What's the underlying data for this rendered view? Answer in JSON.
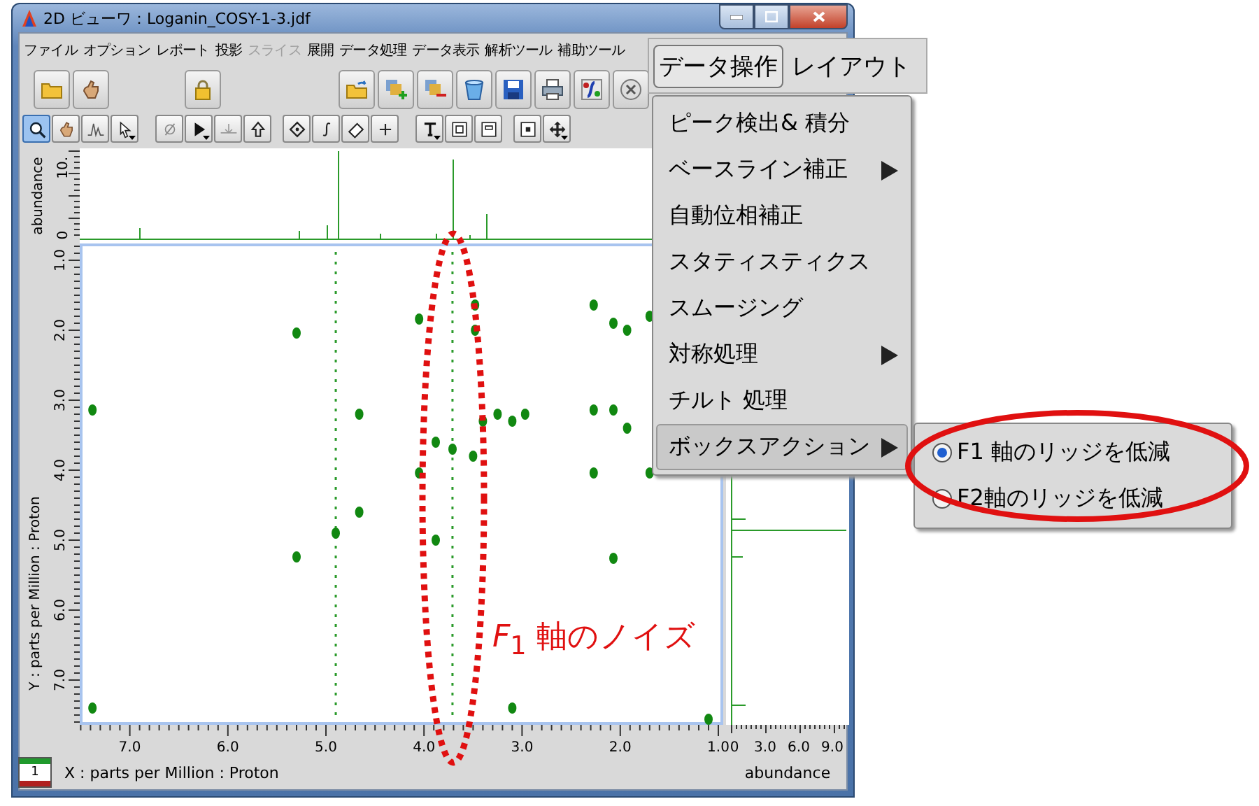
{
  "window": {
    "title": "2D ビューワ：Loganin_COSY-1-3.jdf"
  },
  "menubar": {
    "items": [
      {
        "label": "ファイル",
        "disabled": false
      },
      {
        "label": "オプション",
        "disabled": false
      },
      {
        "label": "レポート",
        "disabled": false
      },
      {
        "label": "投影",
        "disabled": false
      },
      {
        "label": "スライス",
        "disabled": true
      },
      {
        "label": "展開",
        "disabled": false
      },
      {
        "label": "データ処理",
        "disabled": false
      },
      {
        "label": "データ表示",
        "disabled": false
      },
      {
        "label": "解析ツール",
        "disabled": false
      },
      {
        "label": "補助ツール",
        "disabled": false
      }
    ]
  },
  "open_menu": {
    "items": [
      {
        "label": "データ操作",
        "selected": true
      },
      {
        "label": "レイアウト",
        "selected": false
      }
    ]
  },
  "toolbar_1": {
    "groups": [
      [
        {
          "kind": "folder"
        },
        {
          "kind": "hand"
        }
      ],
      [
        {
          "kind": "lock"
        }
      ],
      [
        {
          "kind": "folder-arrow"
        },
        {
          "kind": "layers-plus"
        },
        {
          "kind": "layers-minus"
        },
        {
          "kind": "bucket"
        },
        {
          "kind": "save"
        },
        {
          "kind": "printer"
        },
        {
          "kind": "script"
        },
        {
          "kind": "circle-x"
        }
      ]
    ]
  },
  "toolbar_2": {
    "groups": [
      [
        {
          "kind": "zoom",
          "selected": true,
          "dropdown": false
        },
        {
          "kind": "hand",
          "selected": false,
          "dropdown": false
        },
        {
          "kind": "peak",
          "selected": false,
          "dropdown": false
        },
        {
          "kind": "pointer",
          "selected": false,
          "dropdown": true
        }
      ],
      [
        {
          "kind": "empty-set",
          "selected": false,
          "dropdown": false
        },
        {
          "kind": "arrow",
          "selected": false,
          "dropdown": true
        },
        {
          "kind": "baseline",
          "selected": false,
          "dropdown": false
        },
        {
          "kind": "up-arrow",
          "selected": false,
          "dropdown": false
        }
      ],
      [
        {
          "kind": "diamond",
          "selected": false,
          "dropdown": false
        },
        {
          "kind": "integral",
          "selected": false,
          "dropdown": false
        },
        {
          "kind": "eraser",
          "selected": false,
          "dropdown": false
        },
        {
          "kind": "plus",
          "selected": false,
          "dropdown": false
        }
      ],
      [
        {
          "kind": "text-tool",
          "selected": false,
          "dropdown": true
        },
        {
          "kind": "panel",
          "selected": false,
          "dropdown": false
        },
        {
          "kind": "panel-corner",
          "selected": false,
          "dropdown": false
        }
      ],
      [
        {
          "kind": "square-dot",
          "selected": false,
          "dropdown": false
        },
        {
          "kind": "move",
          "selected": false,
          "dropdown": true
        }
      ]
    ]
  },
  "top_projection": {
    "ylabel": "abundance",
    "yticks": [
      "10.",
      "0"
    ]
  },
  "plot": {
    "chart_data": {
      "type": "scatter",
      "xlabel": "X : parts per Million : Proton",
      "ylabel": "Y : parts per Million : Proton",
      "ref_lines": [
        {
          "axis": "x",
          "value": 4.9
        },
        {
          "axis": "x",
          "value": 3.71
        }
      ],
      "xlim": [
        7.51,
        0.95
      ],
      "ylim": [
        7.64,
        0.76
      ],
      "xticks": [
        {
          "value": 7,
          "label": "7.0"
        },
        {
          "value": 6,
          "label": "6.0"
        },
        {
          "value": 5,
          "label": "5.0"
        },
        {
          "value": 4,
          "label": "4.0"
        },
        {
          "value": 3,
          "label": "3.0"
        },
        {
          "value": 2,
          "label": "2.0"
        },
        {
          "value": 1,
          "label": "1.0"
        }
      ],
      "yticks": [
        {
          "value": 1,
          "label": "1.0"
        },
        {
          "value": 2,
          "label": "2.0"
        },
        {
          "value": 3,
          "label": "3.0"
        },
        {
          "value": 4,
          "label": "4.0"
        },
        {
          "value": 5,
          "label": "5.0"
        },
        {
          "value": 6,
          "label": "6.0"
        },
        {
          "value": 7,
          "label": "7.0"
        }
      ],
      "x": [
        7.38,
        7.38,
        5.3,
        5.3,
        4.9,
        4.66,
        4.66,
        4.05,
        4.05,
        3.88,
        3.88,
        3.71,
        3.5,
        3.48,
        3.48,
        3.4,
        3.25,
        3.1,
        2.97,
        2.27,
        2.27,
        2.27,
        2.07,
        2.07,
        2.07,
        1.93,
        1.93,
        1.7,
        1.7,
        3.1,
        1.1
      ],
      "series": [
        {
          "color": "#118811",
          "values": [
            3.14,
            7.4,
            2.04,
            5.24,
            4.9,
            3.2,
            4.6,
            4.04,
            1.84,
            3.6,
            5.0,
            3.7,
            3.8,
            1.64,
            2.0,
            3.3,
            3.2,
            3.3,
            3.2,
            1.64,
            3.14,
            4.04,
            1.9,
            3.14,
            5.26,
            2.0,
            3.4,
            1.8,
            4.04,
            7.4,
            7.56
          ]
        }
      ]
    }
  },
  "right_projection": {
    "xticks": [
      "0",
      "3.0",
      "6.0",
      "9.0"
    ],
    "xlabel": "abundance"
  },
  "page_indicator": "1",
  "dropdown": {
    "items": [
      {
        "label": "ピーク検出& 積分",
        "submenu": false,
        "selected": false
      },
      {
        "label": "ベースライン補正",
        "submenu": true,
        "selected": false
      },
      {
        "label": "自動位相補正",
        "submenu": false,
        "selected": false
      },
      {
        "label": "スタティスティクス",
        "submenu": false,
        "selected": false
      },
      {
        "label": "スムージング",
        "submenu": false,
        "selected": false
      },
      {
        "label": "対称処理",
        "submenu": true,
        "selected": false
      },
      {
        "label": "チルト 処理",
        "submenu": false,
        "selected": false
      },
      {
        "label": "ボックスアクション",
        "submenu": true,
        "selected": true
      }
    ]
  },
  "submenu": {
    "items": [
      {
        "label": "F1 軸のリッジを低減",
        "selected": true
      },
      {
        "label": "F2軸のリッジを低減",
        "selected": false
      }
    ]
  },
  "annotation": {
    "text": "*F*$_{1}$ 軸のノイズ"
  }
}
